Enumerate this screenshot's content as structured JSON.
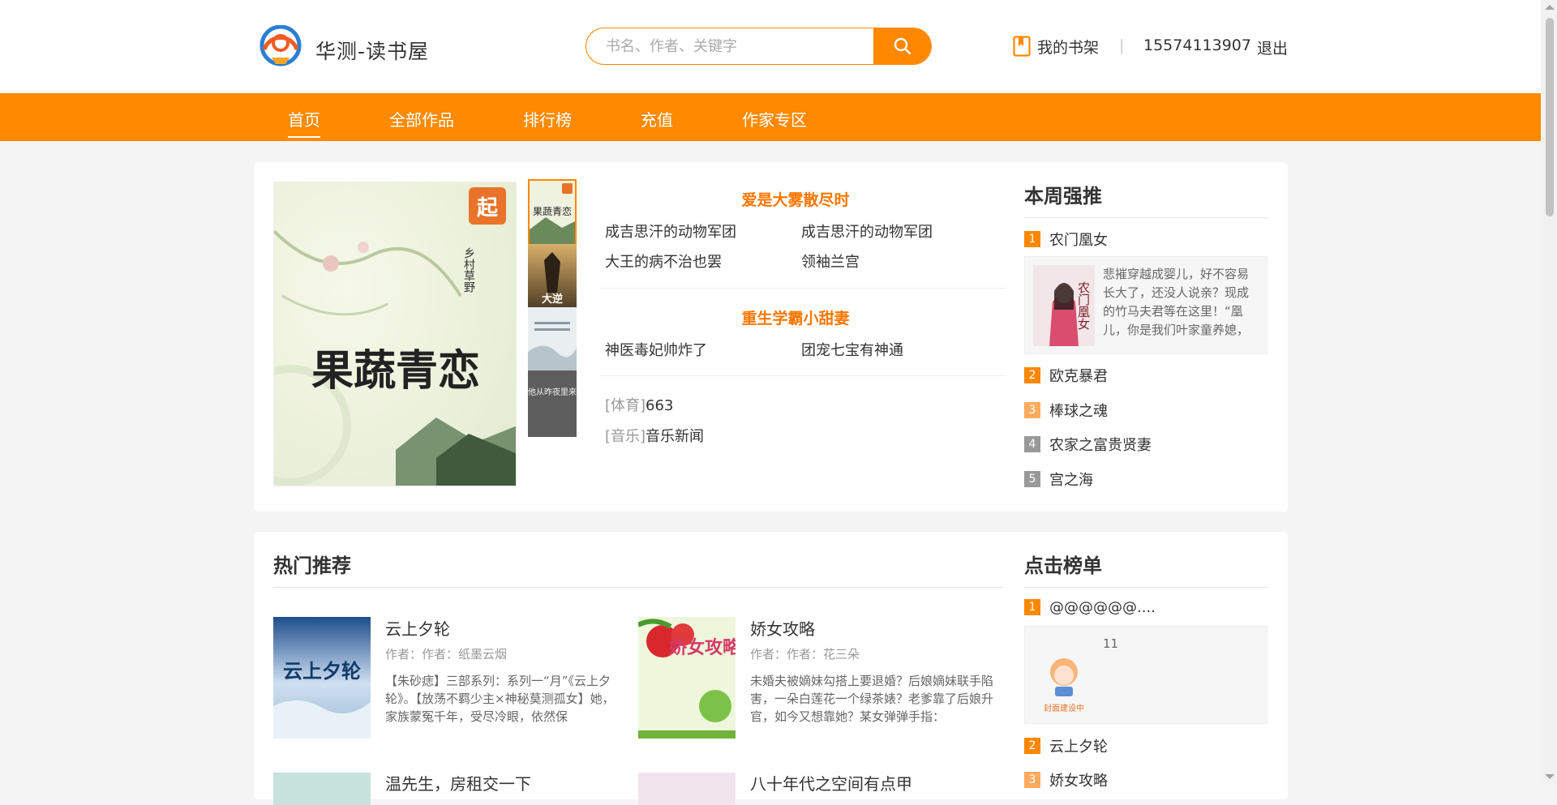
{
  "header": {
    "site_title": "华测-读书屋",
    "search_placeholder": "书名、作者、关键字",
    "bookshelf_label": "我的书架",
    "separator": "|",
    "phone": "15574113907",
    "logout_label": "退出"
  },
  "nav": {
    "items": [
      "首页",
      "全部作品",
      "排行榜",
      "充值",
      "作家专区"
    ],
    "active": "首页"
  },
  "featured": {
    "section1_title": "爱是大雾散尽时",
    "section1_links": [
      "成吉思汗的动物军团",
      "成吉思汗的动物军团",
      "大王的病不治也罢",
      "领袖兰宫"
    ],
    "section2_title": "重生学霸小甜妻",
    "section2_links": [
      "神医毒妃帅炸了",
      "团宠七宝有神通"
    ],
    "category_items": [
      {
        "category": "[体育]",
        "name": "663"
      },
      {
        "category": "[音乐]",
        "name": "音乐新闻"
      }
    ],
    "big_cover_title": "果蔬青恋",
    "big_cover_author": "乡村草野",
    "thumb_texts": [
      "果蔬青恋",
      "大逆",
      "",
      "他从昨夜里来"
    ]
  },
  "weekly": {
    "title": "本周强推",
    "items": [
      {
        "rank": "1",
        "name": "农门凰女"
      },
      {
        "rank": "2",
        "name": "欧克暴君"
      },
      {
        "rank": "3",
        "name": "棒球之魂"
      },
      {
        "rank": "4",
        "name": "农家之富贵贤妻"
      },
      {
        "rank": "5",
        "name": "宫之海"
      }
    ],
    "top_desc": "悲摧穿越成婴儿，好不容易长大了，还没人说亲？现成的竹马夫君等在这里！“凰儿，你是我们叶家童养媳，",
    "top_cover_text": "农门凰女"
  },
  "hot": {
    "title": "热门推荐",
    "books": [
      {
        "title": "云上夕轮",
        "author": "作者：作者：纸墨云烟",
        "desc": "【朱砂痣】三部系列：系列一“月”《云上夕轮》。【放荡不羁少主×神秘莫测孤女】她，家族蒙冤千年，受尽冷眼，依然保",
        "cover_text": "云上夕轮"
      },
      {
        "title": "娇女攻略",
        "author": "作者：作者：花三朵",
        "desc": "未婚夫被嫡妹勾搭上要退婚？后娘嫡妹联手陷害，一朵白莲花一个绿茶婊？老爹靠了后娘升官，如今又想靠她？某女弹弹手指：",
        "cover_text": "娇女攻略"
      },
      {
        "title": "温先生，房租交一下",
        "author": "",
        "desc": "",
        "cover_text": ""
      },
      {
        "title": "八十年代之空间有点甲",
        "author": "",
        "desc": "",
        "cover_text": ""
      }
    ]
  },
  "clicks": {
    "title": "点击榜单",
    "items": [
      {
        "rank": "1",
        "name": "@@@@@@...."
      },
      {
        "rank": "2",
        "name": "云上夕轮"
      },
      {
        "rank": "3",
        "name": "娇女攻略"
      }
    ],
    "top_desc": "11",
    "cover_placeholder": "封面建设中"
  },
  "colors": {
    "accent": "#ff8a00",
    "text": "#333333"
  }
}
